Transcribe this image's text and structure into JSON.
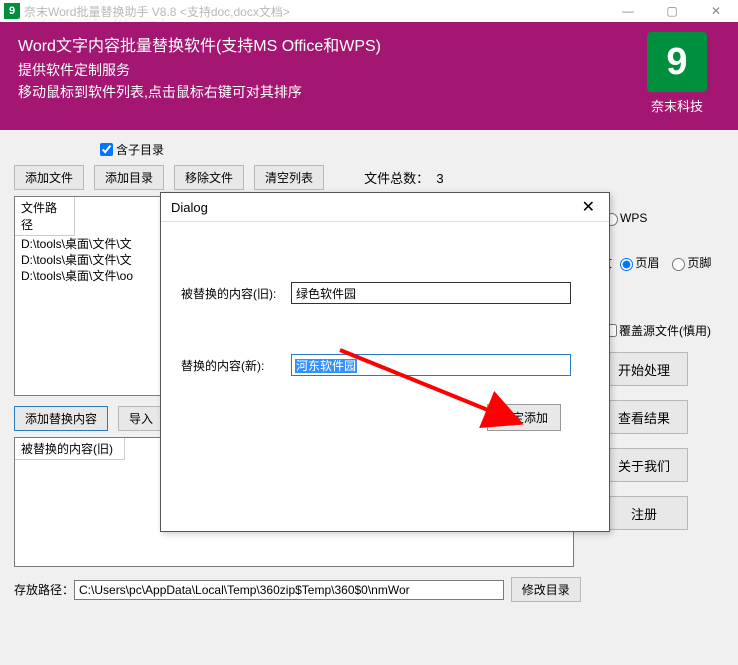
{
  "titlebar": {
    "title": "奈末Word批量替换助手   V8.8   <支持doc,docx文档>",
    "app_icon_text": "9"
  },
  "watermark": "河东软件园",
  "banner": {
    "line1": "Word文字内容批量替换软件(支持MS Office和WPS)",
    "line2": "提供软件定制服务",
    "line3": "移动鼠标到软件列表,点击鼠标右键可对其排序",
    "logo_char": "9",
    "logo_text": "奈末科技"
  },
  "toolbar": {
    "include_sub": "含子目录",
    "add_file": "添加文件",
    "add_dir": "添加目录",
    "remove_file": "移除文件",
    "clear_list": "清空列表",
    "count_label": "文件总数：",
    "count_value": "3"
  },
  "filelist": {
    "header": "文件路径",
    "rows": [
      "D:\\tools\\桌面\\文件\\文",
      "D:\\tools\\桌面\\文件\\文",
      "D:\\tools\\桌面\\文件\\oo"
    ]
  },
  "right": {
    "wps": "WPS",
    "replace_scope_label": "文",
    "header_radio": "页眉",
    "footer_radio": "页脚",
    "overwrite": "覆盖源文件(慎用)",
    "btn_start": "开始处理",
    "btn_result": "查看结果",
    "btn_about": "关于我们",
    "btn_register": "注册"
  },
  "replace": {
    "add_content": "添加替换内容",
    "import": "导入",
    "header_col": "被替换的内容(旧)"
  },
  "save": {
    "label": "存放路径：",
    "path": "C:\\Users\\pc\\AppData\\Local\\Temp\\360zip$Temp\\360$0\\nmWor",
    "change_dir": "修改目录"
  },
  "dialog": {
    "title": "Dialog",
    "old_label": "被替换的内容(旧):",
    "old_value": "绿色软件园",
    "new_label": "替换的内容(新):",
    "new_value": "河东软件园",
    "confirm": "确定添加"
  }
}
